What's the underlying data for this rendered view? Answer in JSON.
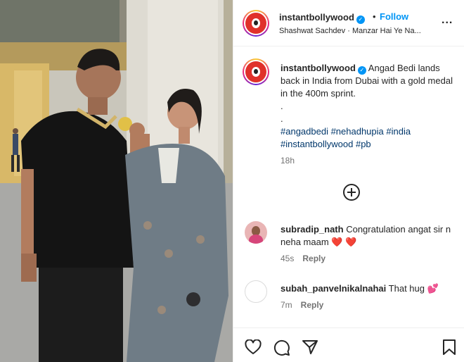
{
  "post": {
    "username": "instantbollywood",
    "follow_label": "Follow",
    "separator": "•",
    "audio": "Shashwat Sachdev · Manzar Hai Ye Na...",
    "more_label": "...",
    "caption": {
      "username": "instantbollywood",
      "text": "Angad Bedi lands back in India from Dubai with a gold medal in the 400m sprint.",
      "dot1": ".",
      "dot2": ".",
      "hashtags_line1": "#angadbedi #nehadhupia #india",
      "hashtags_line2": "#instantbollywood #pb",
      "time": "18h"
    },
    "comments": [
      {
        "username": "subradip_nath",
        "text": "Congratulation angat sir n neha maam",
        "emoji": "❤️ ❤️",
        "time": "45s",
        "reply_label": "Reply"
      },
      {
        "username": "subah_panvelnikalnahai",
        "text": "That hug",
        "emoji": "💕",
        "time": "7m",
        "reply_label": "Reply"
      }
    ]
  },
  "icons": {
    "verified": "verified-badge-icon",
    "load_more": "plus-circle-icon",
    "like": "heart-icon",
    "comment": "comment-icon",
    "share": "share-icon",
    "save": "bookmark-icon"
  },
  "colors": {
    "link": "#0095f6",
    "hashtag": "#00376b",
    "muted": "#737373",
    "text": "#262626"
  }
}
